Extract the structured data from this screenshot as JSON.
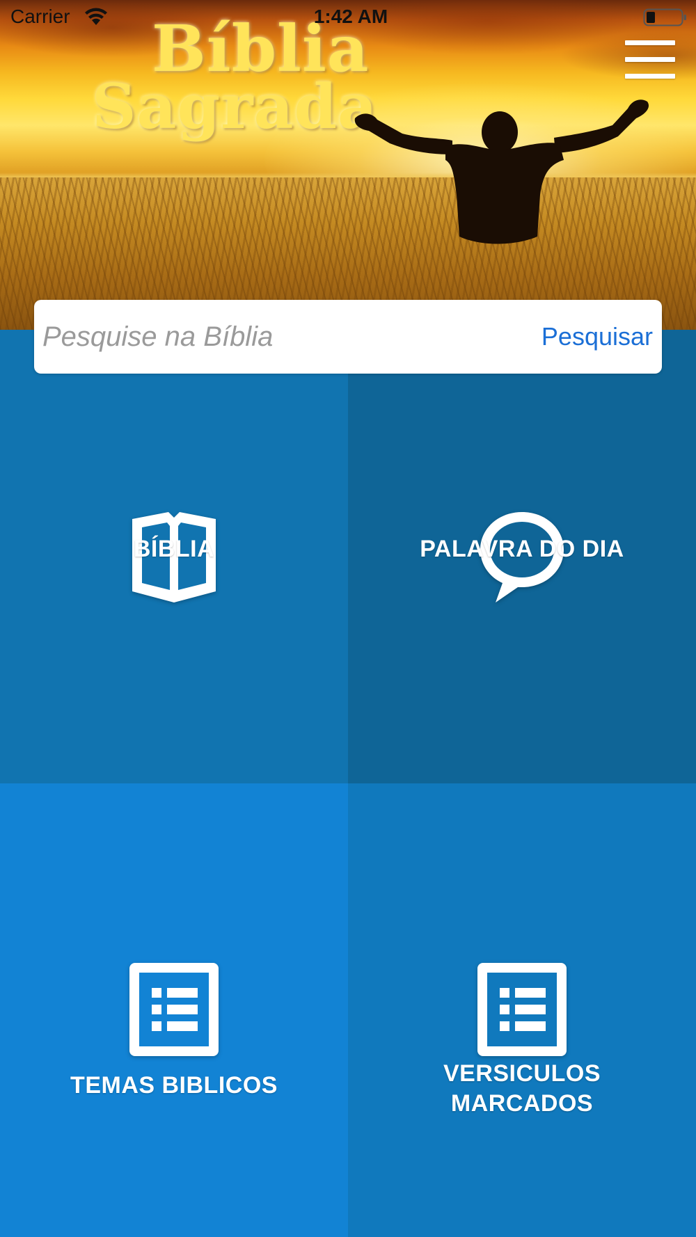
{
  "status_bar": {
    "carrier": "Carrier",
    "time": "1:42 AM"
  },
  "hero": {
    "title_line1": "Bíblia",
    "title_line2": "Sagrada"
  },
  "search": {
    "placeholder": "Pesquise na Bíblia",
    "button_label": "Pesquisar"
  },
  "tiles": [
    {
      "label": "BÍBLIA",
      "icon": "open-book-icon",
      "color": "#1174b0"
    },
    {
      "label": "PALAVRA DO DIA",
      "icon": "speech-bubble-icon",
      "color": "#0f6597"
    },
    {
      "label": "TEMAS BIBLICOS",
      "icon": "list-icon",
      "color": "#1283d4"
    },
    {
      "label_line1": "VERSICULOS",
      "label_line2": "MARCADOS",
      "icon": "list-icon",
      "color": "#1079bd"
    }
  ],
  "colors": {
    "search_button": "#1b6fd6",
    "placeholder": "#9a9a9a"
  }
}
